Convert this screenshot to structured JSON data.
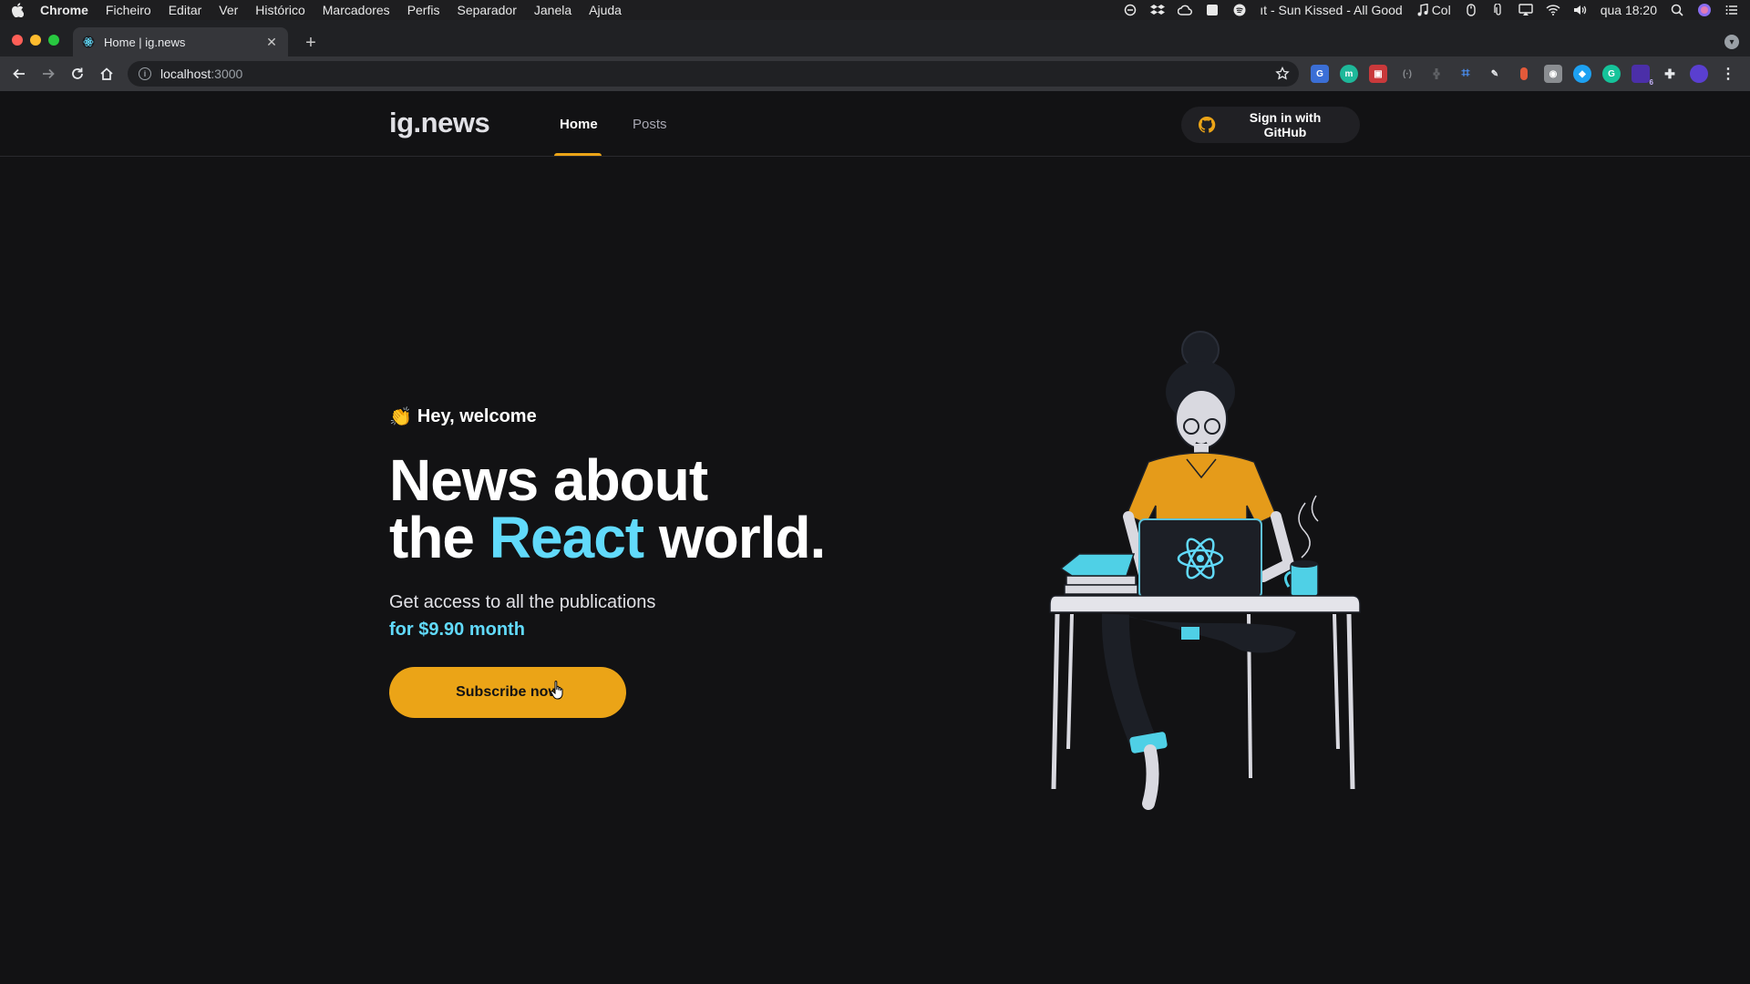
{
  "menubar": {
    "items": [
      "Chrome",
      "Ficheiro",
      "Editar",
      "Ver",
      "Histórico",
      "Marcadores",
      "Perfis",
      "Separador",
      "Janela",
      "Ajuda"
    ],
    "now_playing": "ıt - Sun Kissed - All Good",
    "music_short": "Col",
    "clock": "qua 18:20"
  },
  "browser": {
    "tab_title": "Home | ig.news",
    "url_host": "localhost",
    "url_port": ":3000"
  },
  "site": {
    "logo": "ig.news",
    "nav": {
      "home": "Home",
      "posts": "Posts"
    },
    "github_button": "Sign in with GitHub"
  },
  "hero": {
    "welcome_emoji": "👏",
    "welcome": "Hey, welcome",
    "headline_line1": "News about",
    "headline_the": "the",
    "headline_accent": "React",
    "headline_world": "world.",
    "desc_line": "Get access to all the publications",
    "price_line": "for $9.90 month",
    "subscribe": "Subscribe now"
  },
  "colors": {
    "background": "#121214",
    "accent_yellow": "#eba417",
    "accent_cyan": "#61dafb"
  },
  "extension_badge": "6"
}
